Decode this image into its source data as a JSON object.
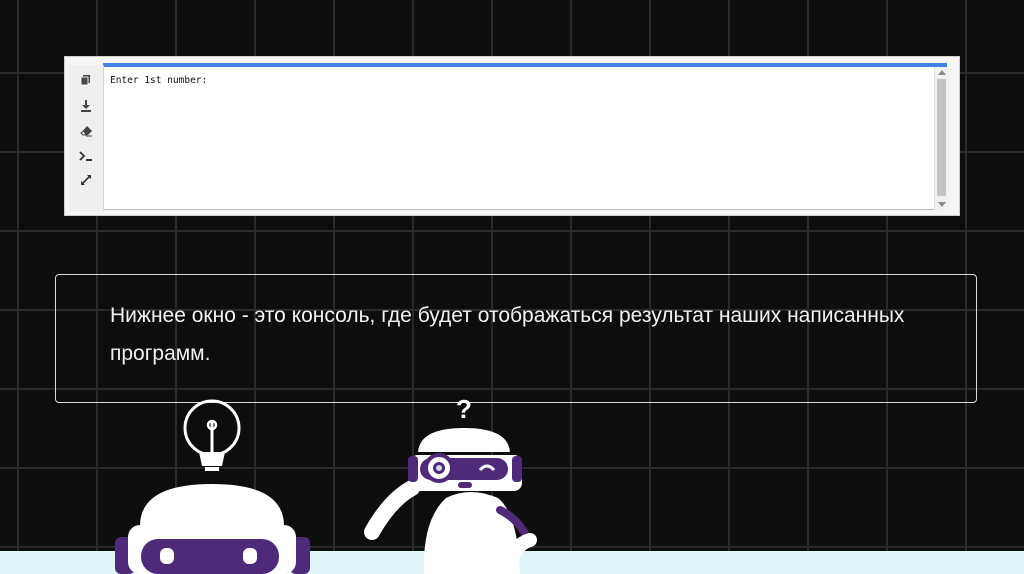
{
  "console": {
    "output_line": "Enter 1st number:",
    "tools": [
      {
        "name": "copy-icon"
      },
      {
        "name": "download-icon"
      },
      {
        "name": "eraser-icon"
      },
      {
        "name": "terminal-icon"
      },
      {
        "name": "expand-icon"
      }
    ],
    "accent_color": "#3f83e6"
  },
  "caption": {
    "text": "Нижнее окно - это консоль, где будет отображаться результат наших написанных программ."
  },
  "robot_right": {
    "question_mark": "?"
  },
  "colors": {
    "background": "#0d0d0d",
    "robot_purple": "#4e2a78",
    "floor": "#dff5f7"
  }
}
